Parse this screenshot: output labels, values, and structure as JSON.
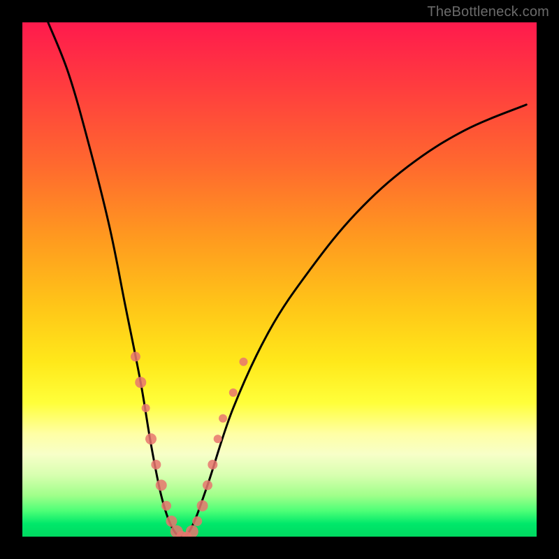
{
  "watermark": "TheBottleneck.com",
  "colors": {
    "curve": "#000000",
    "dot": "#e8766f",
    "frame": "#000000"
  },
  "chart_data": {
    "type": "line",
    "title": "",
    "xlabel": "",
    "ylabel": "",
    "xlim": [
      0,
      100
    ],
    "ylim": [
      0,
      100
    ],
    "series": [
      {
        "name": "bottleneck-curve",
        "points": [
          {
            "x": 5,
            "y": 100
          },
          {
            "x": 9,
            "y": 90
          },
          {
            "x": 13,
            "y": 76
          },
          {
            "x": 17,
            "y": 60
          },
          {
            "x": 20,
            "y": 45
          },
          {
            "x": 23,
            "y": 30
          },
          {
            "x": 25,
            "y": 18
          },
          {
            "x": 27,
            "y": 8
          },
          {
            "x": 29,
            "y": 2
          },
          {
            "x": 31,
            "y": 0
          },
          {
            "x": 33,
            "y": 2
          },
          {
            "x": 36,
            "y": 10
          },
          {
            "x": 41,
            "y": 25
          },
          {
            "x": 48,
            "y": 40
          },
          {
            "x": 56,
            "y": 52
          },
          {
            "x": 65,
            "y": 63
          },
          {
            "x": 75,
            "y": 72
          },
          {
            "x": 86,
            "y": 79
          },
          {
            "x": 98,
            "y": 84
          }
        ]
      }
    ],
    "scatter": [
      {
        "x": 22,
        "y": 35,
        "r": 7
      },
      {
        "x": 23,
        "y": 30,
        "r": 8
      },
      {
        "x": 24,
        "y": 25,
        "r": 6
      },
      {
        "x": 25,
        "y": 19,
        "r": 8
      },
      {
        "x": 26,
        "y": 14,
        "r": 7
      },
      {
        "x": 27,
        "y": 10,
        "r": 8
      },
      {
        "x": 28,
        "y": 6,
        "r": 7
      },
      {
        "x": 29,
        "y": 3,
        "r": 8
      },
      {
        "x": 30,
        "y": 1,
        "r": 9
      },
      {
        "x": 31,
        "y": 0,
        "r": 8
      },
      {
        "x": 32,
        "y": 0,
        "r": 7
      },
      {
        "x": 33,
        "y": 1,
        "r": 9
      },
      {
        "x": 34,
        "y": 3,
        "r": 7
      },
      {
        "x": 35,
        "y": 6,
        "r": 8
      },
      {
        "x": 36,
        "y": 10,
        "r": 7
      },
      {
        "x": 37,
        "y": 14,
        "r": 7
      },
      {
        "x": 38,
        "y": 19,
        "r": 6
      },
      {
        "x": 39,
        "y": 23,
        "r": 6
      },
      {
        "x": 41,
        "y": 28,
        "r": 6
      },
      {
        "x": 43,
        "y": 34,
        "r": 6
      }
    ]
  }
}
